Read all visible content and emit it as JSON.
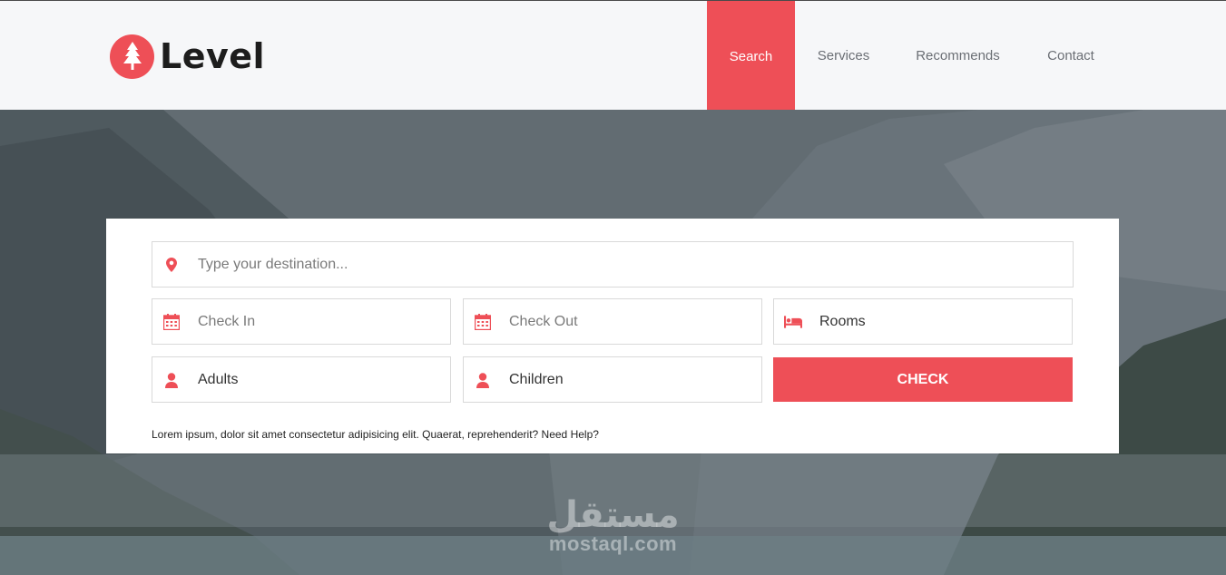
{
  "brand": {
    "name": "Level",
    "icon": "pine-tree-icon",
    "color": "#ee4f57"
  },
  "nav": {
    "items": [
      {
        "label": "Search",
        "active": true
      },
      {
        "label": "Services",
        "active": false
      },
      {
        "label": "Recommends",
        "active": false
      },
      {
        "label": "Contact",
        "active": false
      }
    ]
  },
  "booking": {
    "destination": {
      "placeholder": "Type your destination...",
      "icon": "map-pin-icon"
    },
    "check_in": {
      "placeholder": "Check In",
      "icon": "calendar-icon"
    },
    "check_out": {
      "placeholder": "Check Out",
      "icon": "calendar-icon"
    },
    "rooms": {
      "value": "Rooms",
      "icon": "bed-icon"
    },
    "adults": {
      "value": "Adults",
      "icon": "user-icon"
    },
    "children": {
      "value": "Children",
      "icon": "user-icon"
    },
    "check_label": "CHECK",
    "note": "Lorem ipsum, dolor sit amet consectetur adipisicing elit. Quaerat, reprehenderit? Need Help?"
  },
  "watermark": {
    "arabic": "مستقل",
    "latin": "mostaql.com"
  }
}
